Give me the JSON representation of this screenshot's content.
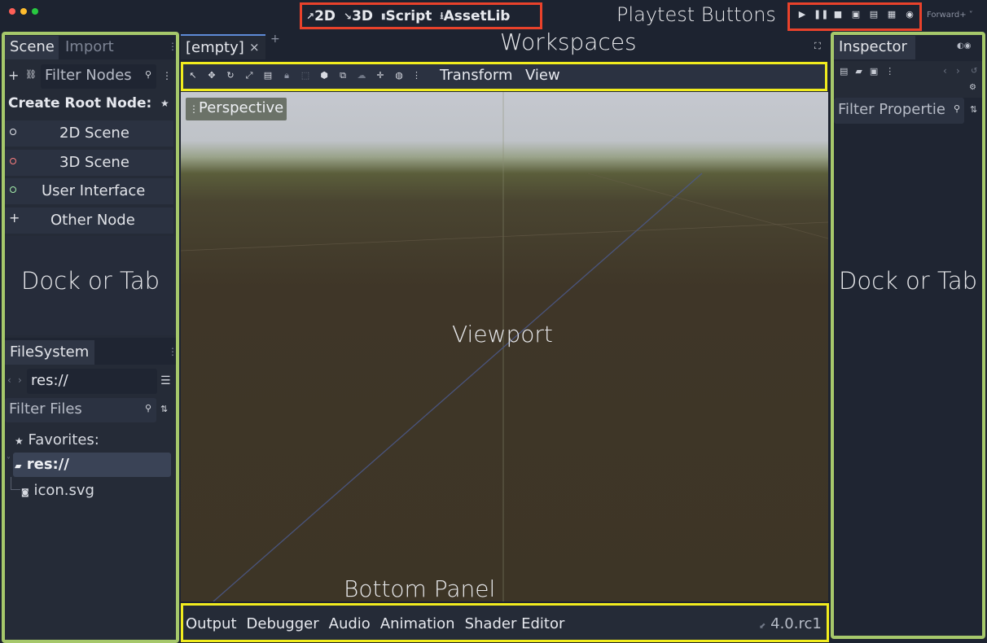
{
  "window": {
    "traffic_lights": [
      "#fe5f57",
      "#febc2e",
      "#28c840"
    ]
  },
  "workspaces": [
    {
      "icon": "2d-icon",
      "glyph": "↗",
      "label": "2D"
    },
    {
      "icon": "3d-icon",
      "glyph": "↘",
      "label": "3D"
    },
    {
      "icon": "script-icon",
      "glyph": "▮",
      "label": "Script"
    },
    {
      "icon": "assetlib-icon",
      "glyph": "⭳",
      "label": "AssetLib"
    }
  ],
  "annotations": {
    "playtest": "Playtest Buttons",
    "workspaces": "Workspaces",
    "dock_left": "Dock or Tab",
    "dock_right": "Dock or Tab",
    "viewport": "Viewport",
    "bottom_panel": "Bottom Panel",
    "colors": {
      "dock": "#a6c86b",
      "red": "#e9422b",
      "yellow": "#f1ec1e"
    }
  },
  "playtest": {
    "renderer": "Forward+",
    "buttons": [
      "play-icon",
      "pause-icon",
      "stop-icon",
      "remote-debug-icon",
      "movie-icon",
      "play-scene-icon",
      "play-custom-icon"
    ]
  },
  "scene_dock": {
    "tab_scene": "Scene",
    "tab_import": "Import",
    "filter_placeholder": "Filter Nodes",
    "create_root": "Create Root Node:",
    "items": [
      {
        "label": "2D Scene",
        "icon": "circle-icon",
        "color": "#e6e8ee"
      },
      {
        "label": "3D Scene",
        "icon": "circle-icon",
        "color": "#fc7f7f"
      },
      {
        "label": "User Interface",
        "icon": "circle-icon",
        "color": "#a5efac"
      },
      {
        "label": "Other Node",
        "icon": "plus-icon",
        "color": "#e6e8ee"
      }
    ]
  },
  "filesystem": {
    "tab": "FileSystem",
    "path": "res://",
    "filter_placeholder": "Filter Files",
    "favorites": "Favorites:",
    "root": "res://",
    "file": "icon.svg"
  },
  "editor": {
    "tab": "[empty]",
    "close": "×",
    "add": "+",
    "menu_transform": "Transform",
    "menu_view": "View",
    "perspective": "Perspective"
  },
  "bottom": {
    "tabs": [
      "Output",
      "Debugger",
      "Audio",
      "Animation",
      "Shader Editor"
    ],
    "version": "4.0.rc1"
  },
  "inspector": {
    "tab": "Inspector",
    "filter_placeholder": "Filter Propertie"
  }
}
